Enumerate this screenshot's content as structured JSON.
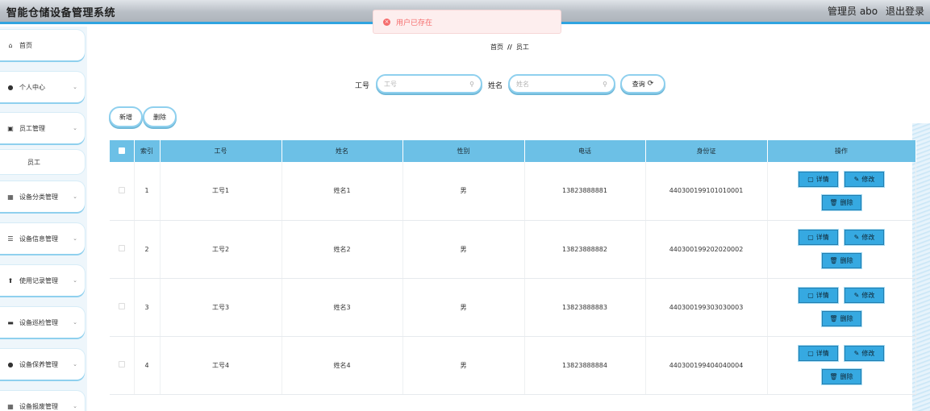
{
  "header": {
    "title": "智能仓储设备管理系统",
    "admin": "管理员 abo",
    "logout": "退出登录"
  },
  "toast": {
    "message": "用户已存在"
  },
  "sidebar": {
    "items": [
      {
        "label": "首页",
        "icon": "home-icon",
        "glyph": "⌂",
        "arrow": ""
      },
      {
        "label": "个人中心",
        "icon": "user-icon",
        "glyph": "●",
        "arrow": "⌄"
      },
      {
        "label": "员工管理",
        "icon": "edit-icon",
        "glyph": "▣",
        "arrow": "⌄"
      },
      {
        "label": "设备分类管理",
        "icon": "grid-icon",
        "glyph": "▦",
        "arrow": "⌄"
      },
      {
        "label": "设备信息管理",
        "icon": "list-icon",
        "glyph": "☰",
        "arrow": "⌄"
      },
      {
        "label": "使用记录管理",
        "icon": "upload-icon",
        "glyph": "⬆",
        "arrow": "⌄"
      },
      {
        "label": "设备巡检管理",
        "icon": "card-icon",
        "glyph": "▬",
        "arrow": "⌄"
      },
      {
        "label": "设备保养管理",
        "icon": "user-icon",
        "glyph": "●",
        "arrow": "⌄"
      },
      {
        "label": "设备报废管理",
        "icon": "grid-icon",
        "glyph": "▦",
        "arrow": "⌄"
      }
    ],
    "subitem": "员工"
  },
  "breadcrumb": {
    "home": "首页",
    "sep": "//",
    "current": "员工"
  },
  "search": {
    "label1": "工号",
    "placeholder1": "工号",
    "label2": "姓名",
    "placeholder2": "姓名",
    "query_label": "查询",
    "query_icon": "⟳"
  },
  "actions": {
    "add": "新增",
    "delete": "删除"
  },
  "table": {
    "columns": [
      "索引",
      "工号",
      "姓名",
      "性别",
      "电话",
      "身份证",
      "操作"
    ],
    "rows": [
      {
        "index": "1",
        "no": "工号1",
        "name": "姓名1",
        "gender": "男",
        "phone": "13823888881",
        "id": "440300199101010001"
      },
      {
        "index": "2",
        "no": "工号2",
        "name": "姓名2",
        "gender": "男",
        "phone": "13823888882",
        "id": "440300199202020002"
      },
      {
        "index": "3",
        "no": "工号3",
        "name": "姓名3",
        "gender": "男",
        "phone": "13823888883",
        "id": "440300199303030003"
      },
      {
        "index": "4",
        "no": "工号4",
        "name": "姓名4",
        "gender": "男",
        "phone": "13823888884",
        "id": "440300199404040004"
      }
    ],
    "ops": {
      "detail": "详情",
      "edit": "修改",
      "remove": "删除"
    }
  },
  "colors": {
    "accent": "#36a9e1",
    "header_bg": "#6cc0e6",
    "toast": "#f56c6c"
  }
}
